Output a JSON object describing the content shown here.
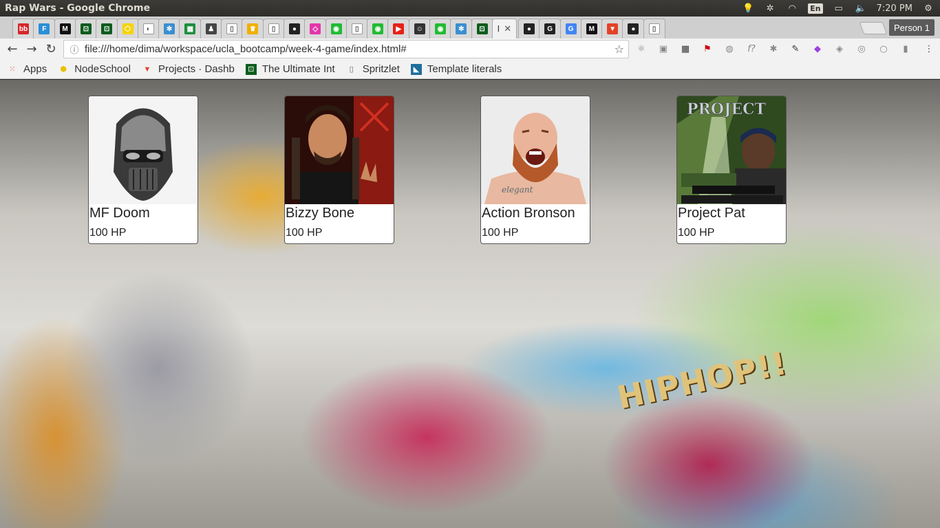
{
  "os": {
    "window_title": "Rap Wars - Google Chrome",
    "keyboard_layout": "En",
    "clock": "7:20 PM"
  },
  "browser": {
    "url": "file:///home/dima/workspace/ucla_bootcamp/week-4-game/index.html#",
    "profile_label": "Person 1",
    "active_tab_label": "I",
    "tabs": [
      {
        "icon": "bb-icon",
        "color": "#d6262b",
        "glyph": "bb"
      },
      {
        "icon": "f-icon",
        "color": "#2b8fd6",
        "glyph": "F"
      },
      {
        "icon": "medium-icon",
        "color": "#111111",
        "glyph": "M"
      },
      {
        "icon": "codecademy-icon",
        "color": "#0d5c1d",
        "glyph": "⊡"
      },
      {
        "icon": "codecademy-icon",
        "color": "#0d5c1d",
        "glyph": "⊡"
      },
      {
        "icon": "nodeschool-icon",
        "color": "#f5d400",
        "glyph": "⬡"
      },
      {
        "icon": "circle-icon",
        "color": "#ffffff",
        "glyph": "◐"
      },
      {
        "icon": "gear-icon",
        "color": "#3a8fd0",
        "glyph": "✻"
      },
      {
        "icon": "sheets-icon",
        "color": "#1e8e3e",
        "glyph": "▦"
      },
      {
        "icon": "person-icon",
        "color": "#444444",
        "glyph": "♟"
      },
      {
        "icon": "page-icon",
        "color": "#ffffff",
        "glyph": "▯"
      },
      {
        "icon": "crown-icon",
        "color": "#f0b000",
        "glyph": "♛"
      },
      {
        "icon": "page-icon",
        "color": "#ffffff",
        "glyph": "▯"
      },
      {
        "icon": "github-icon",
        "color": "#222222",
        "glyph": "●"
      },
      {
        "icon": "graphql-icon",
        "color": "#e535ab",
        "glyph": "◇"
      },
      {
        "icon": "android-icon",
        "color": "#22bb33",
        "glyph": "◉"
      },
      {
        "icon": "page-icon",
        "color": "#ffffff",
        "glyph": "▯"
      },
      {
        "icon": "android-icon",
        "color": "#22bb33",
        "glyph": "◉"
      },
      {
        "icon": "youtube-icon",
        "color": "#e62117",
        "glyph": "▶"
      },
      {
        "icon": "face-icon",
        "color": "#333333",
        "glyph": "☺"
      },
      {
        "icon": "android-icon",
        "color": "#22bb33",
        "glyph": "◉"
      },
      {
        "icon": "gear-icon",
        "color": "#3a8fd0",
        "glyph": "✻"
      },
      {
        "icon": "codecademy-icon",
        "color": "#0d5c1d",
        "glyph": "⊡"
      }
    ],
    "tabs_after_active": [
      {
        "icon": "github-icon",
        "color": "#222222",
        "glyph": "●"
      },
      {
        "icon": "g-icon",
        "color": "#222222",
        "glyph": "G"
      },
      {
        "icon": "google-icon",
        "color": "#4285f4",
        "glyph": "G"
      },
      {
        "icon": "medium-icon",
        "color": "#111111",
        "glyph": "M"
      },
      {
        "icon": "gitlab-icon",
        "color": "#e24329",
        "glyph": "▼"
      },
      {
        "icon": "github-icon",
        "color": "#222222",
        "glyph": "●"
      },
      {
        "icon": "page-icon",
        "color": "#ffffff",
        "glyph": "▯"
      }
    ]
  },
  "bookmarks": [
    {
      "label": "Apps",
      "icon": "apps-grid-icon"
    },
    {
      "label": "NodeSchool",
      "icon": "nodeschool-icon"
    },
    {
      "label": "Projects · Dashb",
      "icon": "gitlab-icon"
    },
    {
      "label": "The Ultimate Int",
      "icon": "codecademy-icon"
    },
    {
      "label": "Spritzlet",
      "icon": "page-icon"
    },
    {
      "label": "Template literals",
      "icon": "mdn-icon"
    }
  ],
  "characters": [
    {
      "name": "MF Doom",
      "hp": "100 HP",
      "photo": "metal-mask"
    },
    {
      "name": "Bizzy Bone",
      "hp": "100 HP",
      "photo": "red-portrait"
    },
    {
      "name": "Action Bronson",
      "hp": "100 HP",
      "photo": "bearded-man"
    },
    {
      "name": "Project Pat",
      "hp": "100 HP",
      "photo": "album-cover"
    }
  ]
}
